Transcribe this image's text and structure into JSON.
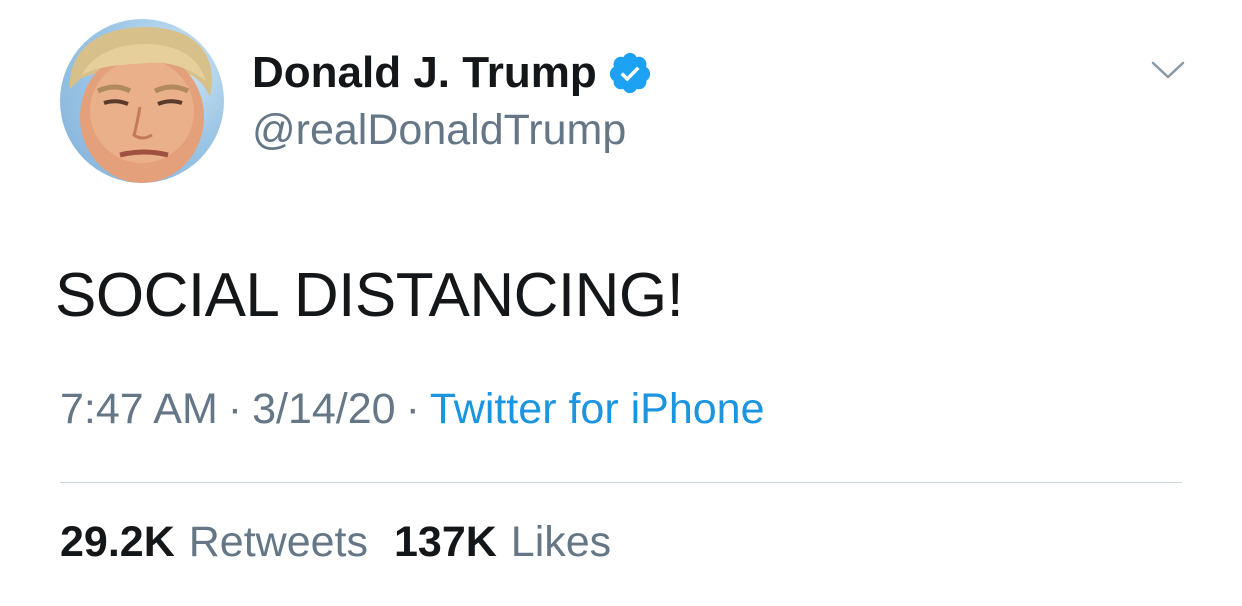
{
  "user": {
    "display_name": "Donald J. Trump",
    "handle": "@realDonaldTrump",
    "verified": true,
    "avatar_icon": "profile-photo",
    "verified_icon": "verified-badge-icon"
  },
  "tweet": {
    "text": "SOCIAL DISTANCING!",
    "time": "7:47 AM",
    "date": "3/14/20",
    "separator": "·",
    "source": "Twitter for iPhone"
  },
  "stats": {
    "retweets_count": "29.2K",
    "retweets_label": "Retweets",
    "likes_count": "137K",
    "likes_label": "Likes"
  },
  "menu": {
    "icon": "chevron-down-icon"
  },
  "colors": {
    "text_primary": "#14171a",
    "text_secondary": "#657786",
    "link": "#1b95e0",
    "verified": "#1da1f2",
    "divider": "#ccd6dd"
  }
}
